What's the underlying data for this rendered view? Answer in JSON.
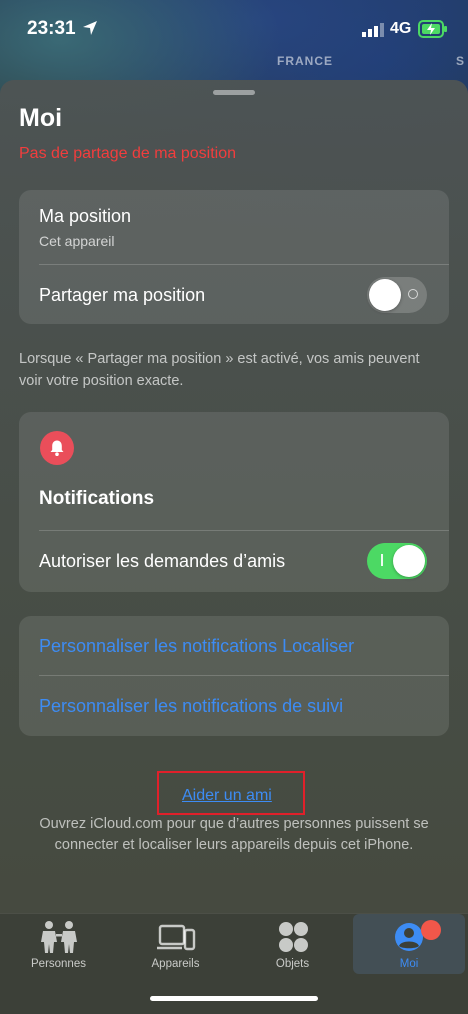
{
  "status": {
    "time": "23:31",
    "network": "4G"
  },
  "map": {
    "label": "FRANCE",
    "label_edge": "S"
  },
  "sheet": {
    "title": "Moi",
    "sharing_status": "Pas de partage de ma position"
  },
  "position_card": {
    "title": "Ma position",
    "subtitle": "Cet appareil",
    "share_label": "Partager ma position",
    "share_enabled": false
  },
  "explanation": "Lorsque « Partager ma position » est activé, vos amis peuvent voir votre position exacte.",
  "notifications_card": {
    "icon": "bell-icon",
    "title": "Notifications",
    "friend_requests_label": "Autoriser les demandes d’amis",
    "friend_requests_enabled": true
  },
  "links_card": {
    "customize_find": "Personnaliser les notifications Localiser",
    "customize_tracking": "Personnaliser les notifications de suivi"
  },
  "help": {
    "link": "Aider un ami",
    "text": "Ouvrez iCloud.com pour que d’autres personnes puissent se connecter et localiser leurs appareils depuis cet iPhone."
  },
  "tabs": [
    {
      "label": "Personnes",
      "icon": "people-icon",
      "active": false
    },
    {
      "label": "Appareils",
      "icon": "devices-icon",
      "active": false
    },
    {
      "label": "Objets",
      "icon": "items-icon",
      "active": false
    },
    {
      "label": "Moi",
      "icon": "me-icon",
      "active": true
    }
  ],
  "colors": {
    "accent": "#3d8cf4",
    "alert": "#f23d3d",
    "toggle_on": "#4cd964"
  }
}
